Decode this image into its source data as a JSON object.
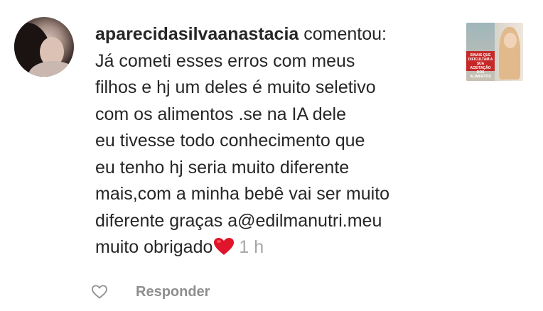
{
  "comment": {
    "username": "aparecidasilvaanastacia",
    "action": "comentou:",
    "lines": [
      "Já cometi esses erros com meus",
      "filhos e hj um deles é muito seletivo",
      "com os alimentos .se na IA dele",
      "eu tivesse todo conhecimento que",
      "eu tenho hj seria muito diferente",
      "mais,com a minha bebê vai ser muito",
      "diferente graças a@edilmanutri.meu",
      "muito obrigado"
    ],
    "time": "1 h"
  },
  "actions": {
    "reply_label": "Responder"
  },
  "post_thumbnail": {
    "caption": "SINAIS QUE DIFICULTAM A SUA ACEITAÇÃO DOS ALIMENTOS"
  },
  "colors": {
    "text": "#262626",
    "muted": "#8e8e8e",
    "timestamp": "#a6a6a6",
    "heart": "#e0142a"
  },
  "icons": {
    "like": "heart-outline-icon",
    "emoji": "red-heart-emoji-icon"
  }
}
